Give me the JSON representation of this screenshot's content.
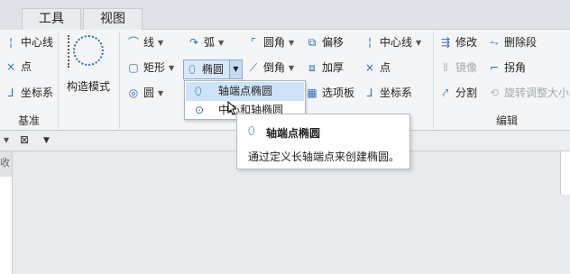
{
  "tabs": [
    {
      "label": "工具"
    },
    {
      "label": "视图"
    }
  ],
  "groups": {
    "jizhun": {
      "label": "基准",
      "items": [
        {
          "label": "中心线",
          "icon": "centerline-icon"
        },
        {
          "label": "点",
          "icon": "point-icon"
        },
        {
          "label": "坐标系",
          "icon": "coordinate-system-icon"
        }
      ]
    },
    "construct": {
      "label": "构造模式",
      "icon": "construction-mode-icon"
    },
    "sketch": {
      "col1": [
        {
          "label": "线",
          "icon": "line-icon"
        },
        {
          "label": "矩形",
          "icon": "rectangle-icon"
        },
        {
          "label": "圆",
          "icon": "circle-icon"
        }
      ],
      "col2": [
        {
          "label": "弧",
          "icon": "arc-icon"
        },
        {
          "label": "椭圆",
          "icon": "ellipse-icon"
        }
      ],
      "col3": [
        {
          "label": "圆角",
          "icon": "fillet-icon"
        },
        {
          "label": "倒角",
          "icon": "chamfer-icon"
        }
      ],
      "col4": [
        {
          "label": "偏移",
          "icon": "offset-icon"
        },
        {
          "label": "加厚",
          "icon": "thicken-icon"
        },
        {
          "label": "选项板",
          "icon": "palette-icon"
        }
      ],
      "col5": [
        {
          "label": "中心线",
          "icon": "centerline-icon"
        },
        {
          "label": "点",
          "icon": "point-icon"
        },
        {
          "label": "坐标系",
          "icon": "coordinate-system-icon"
        }
      ]
    },
    "edit": {
      "label": "编辑",
      "col1": [
        {
          "label": "修改",
          "icon": "modify-icon"
        },
        {
          "label": "镜像",
          "icon": "mirror-icon",
          "disabled": true
        },
        {
          "label": "分割",
          "icon": "divide-icon"
        }
      ],
      "col2": [
        {
          "label": "删除段",
          "icon": "delete-segment-icon"
        },
        {
          "label": "拐角",
          "icon": "corner-icon"
        },
        {
          "label": "旋转调整大小",
          "icon": "rotate-resize-icon",
          "disabled": true
        }
      ]
    }
  },
  "dropdown": {
    "items": [
      {
        "label": "轴端点椭圆",
        "icon": "axis-ends-ellipse-icon"
      },
      {
        "label": "中心和轴椭圆",
        "icon": "center-axis-ellipse-icon"
      }
    ]
  },
  "tooltip": {
    "title": "轴端点椭圆",
    "description": "通过定义长轴端点来创建椭圆。"
  },
  "panel": {
    "dropdown_glyph": "▾",
    "close_glyph": "⊠",
    "filter_glyph": "▼",
    "collapsed_tab": "收"
  }
}
